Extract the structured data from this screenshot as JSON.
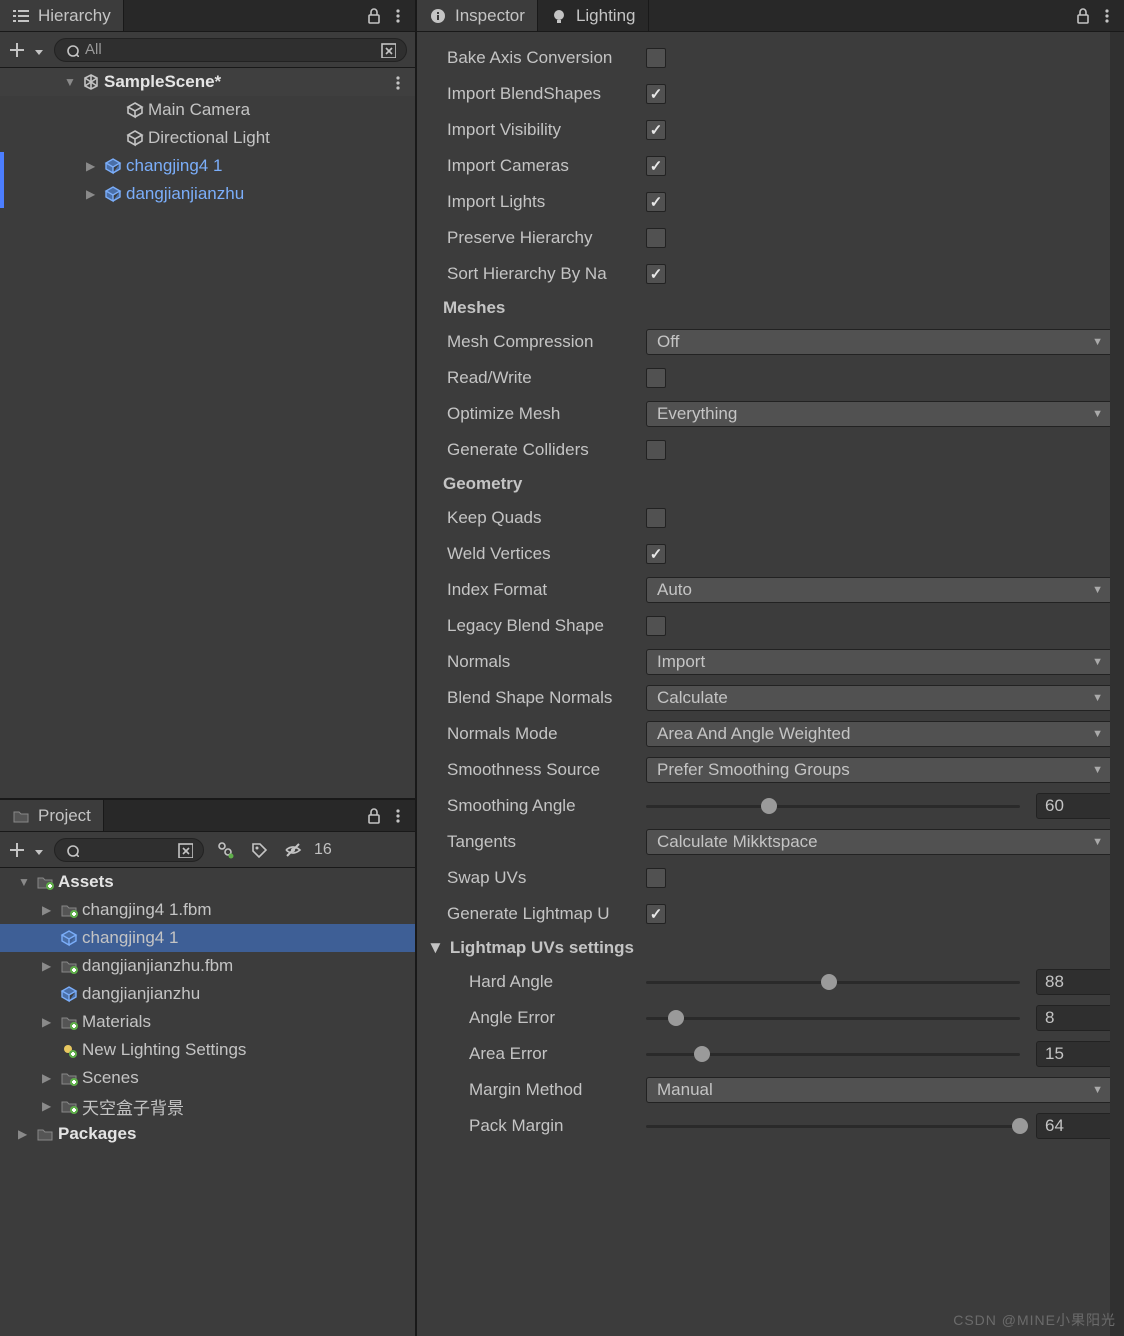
{
  "hierarchy": {
    "tab": "Hierarchy",
    "search_placeholder": "All",
    "scene": "SampleScene*",
    "items": [
      {
        "label": "Main Camera",
        "indent": 2,
        "chev": "",
        "blue": false,
        "marked": false,
        "icon": "cube"
      },
      {
        "label": "Directional Light",
        "indent": 2,
        "chev": "",
        "blue": false,
        "marked": false,
        "icon": "cube"
      },
      {
        "label": "changjing4 1",
        "indent": 1,
        "chev": "▶",
        "blue": true,
        "marked": true,
        "icon": "prefab"
      },
      {
        "label": "dangjianjianzhu",
        "indent": 1,
        "chev": "▶",
        "blue": true,
        "marked": true,
        "icon": "prefab"
      }
    ]
  },
  "project": {
    "tab": "Project",
    "hidden_count": "16",
    "assets_label": "Assets",
    "packages_label": "Packages",
    "items": [
      {
        "label": "changjing4 1.fbm",
        "icon": "folder",
        "sel": false
      },
      {
        "label": "changjing4 1",
        "icon": "prefab",
        "sel": true
      },
      {
        "label": "dangjianjianzhu.fbm",
        "icon": "folder",
        "sel": false
      },
      {
        "label": "dangjianjianzhu",
        "icon": "prefab",
        "sel": false
      },
      {
        "label": "Materials",
        "icon": "folder",
        "sel": false
      },
      {
        "label": "New Lighting Settings",
        "icon": "light",
        "sel": false
      },
      {
        "label": "Scenes",
        "icon": "folder",
        "sel": false
      },
      {
        "label": "天空盒子背景",
        "icon": "folder",
        "sel": false
      }
    ]
  },
  "inspector": {
    "tabs": {
      "inspector": "Inspector",
      "lighting": "Lighting"
    },
    "props": {
      "bake_axis": "Bake Axis Conversion",
      "import_blendshapes": "Import BlendShapes",
      "import_visibility": "Import Visibility",
      "import_cameras": "Import Cameras",
      "import_lights": "Import Lights",
      "preserve_hierarchy": "Preserve Hierarchy",
      "sort_hierarchy": "Sort Hierarchy By Na",
      "meshes": "Meshes",
      "mesh_compression": "Mesh Compression",
      "read_write": "Read/Write",
      "optimize_mesh": "Optimize Mesh",
      "generate_colliders": "Generate Colliders",
      "geometry": "Geometry",
      "keep_quads": "Keep Quads",
      "weld_vertices": "Weld Vertices",
      "index_format": "Index Format",
      "legacy_blend": "Legacy Blend Shape",
      "normals": "Normals",
      "blend_shape_normals": "Blend Shape Normals",
      "normals_mode": "Normals Mode",
      "smoothness_source": "Smoothness Source",
      "smoothing_angle": "Smoothing Angle",
      "tangents": "Tangents",
      "swap_uvs": "Swap UVs",
      "generate_lightmap": "Generate Lightmap U",
      "lightmap_uvs": "Lightmap UVs settings",
      "hard_angle": "Hard Angle",
      "angle_error": "Angle Error",
      "area_error": "Area Error",
      "margin_method": "Margin Method",
      "pack_margin": "Pack Margin"
    },
    "values": {
      "bake_axis": false,
      "import_blendshapes": true,
      "import_visibility": true,
      "import_cameras": true,
      "import_lights": true,
      "preserve_hierarchy": false,
      "sort_hierarchy": true,
      "mesh_compression": "Off",
      "read_write": false,
      "optimize_mesh": "Everything",
      "generate_colliders": false,
      "keep_quads": false,
      "weld_vertices": true,
      "index_format": "Auto",
      "legacy_blend": false,
      "normals": "Import",
      "blend_shape_normals": "Calculate",
      "normals_mode": "Area And Angle Weighted",
      "smoothness_source": "Prefer Smoothing Groups",
      "smoothing_angle": "60",
      "smoothing_angle_pct": 33,
      "tangents": "Calculate Mikktspace",
      "swap_uvs": false,
      "generate_lightmap": true,
      "hard_angle": "88",
      "hard_angle_pct": 49,
      "angle_error": "8",
      "angle_error_pct": 8,
      "area_error": "15",
      "area_error_pct": 15,
      "margin_method": "Manual",
      "pack_margin": "64",
      "pack_margin_pct": 100
    }
  },
  "watermark": "CSDN @MINE小果阳光"
}
